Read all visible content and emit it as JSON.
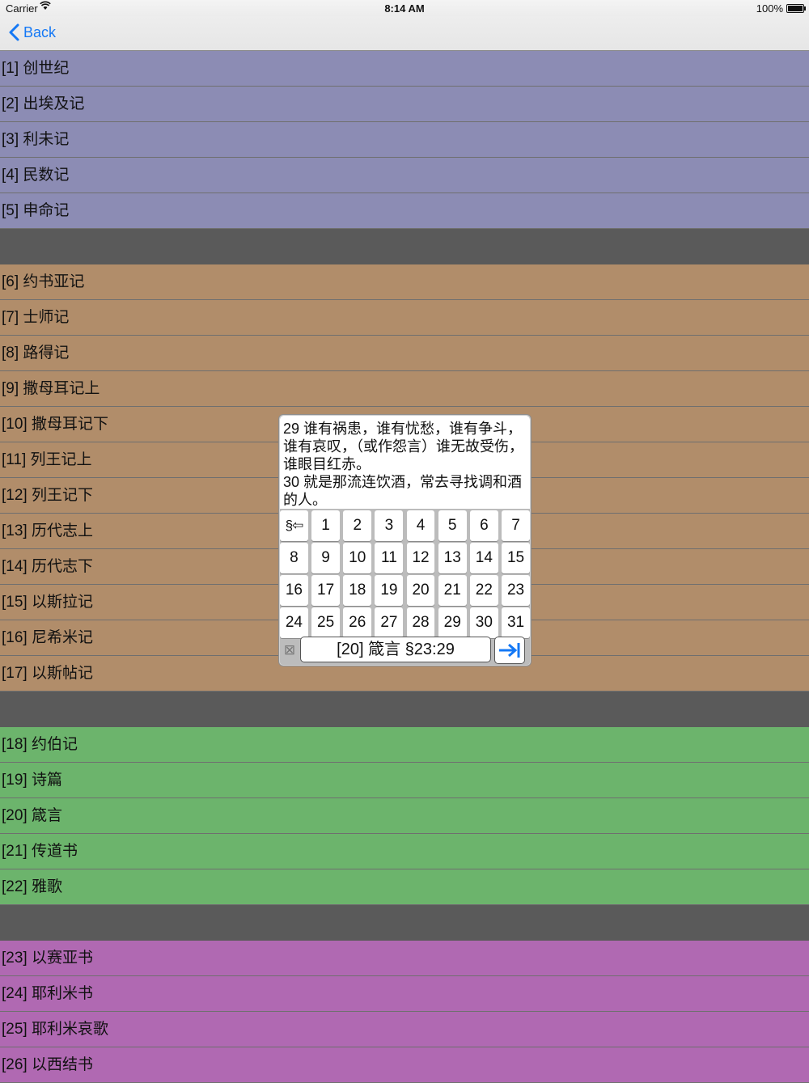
{
  "status": {
    "carrier": "Carrier",
    "time": "8:14 AM",
    "battery": "100%"
  },
  "nav": {
    "back_label": "Back"
  },
  "books": [
    {
      "label": "[1] 创世纪"
    },
    {
      "label": "[2] 出埃及记"
    },
    {
      "label": "[3] 利未记"
    },
    {
      "label": "[4] 民数记"
    },
    {
      "label": "[5] 申命记"
    },
    {
      "label": "[6] 约书亚记"
    },
    {
      "label": "[7] 士师记"
    },
    {
      "label": "[8] 路得记"
    },
    {
      "label": "[9] 撒母耳记上"
    },
    {
      "label": "[10] 撒母耳记下"
    },
    {
      "label": "[11] 列王记上"
    },
    {
      "label": "[12] 列王记下"
    },
    {
      "label": "[13] 历代志上"
    },
    {
      "label": "[14] 历代志下"
    },
    {
      "label": "[15] 以斯拉记"
    },
    {
      "label": "[16] 尼希米记"
    },
    {
      "label": "[17] 以斯帖记"
    },
    {
      "label": "[18] 约伯记"
    },
    {
      "label": "[19] 诗篇"
    },
    {
      "label": "[20] 箴言"
    },
    {
      "label": "[21] 传道书"
    },
    {
      "label": "[22] 雅歌"
    },
    {
      "label": "[23] 以赛亚书"
    },
    {
      "label": "[24] 耶利米书"
    },
    {
      "label": "[25] 耶利米哀歌"
    },
    {
      "label": "[26] 以西结书"
    }
  ],
  "colors": {
    "law": "#8c8cb4",
    "history": "#b18d6a",
    "poetry": "#6cb46c",
    "prophets": "#b069b2",
    "accent": "#1478f5"
  },
  "popup": {
    "verses": [
      "29  谁有祸患，谁有忧愁，谁有争斗，谁有哀叹，（或作怨言）谁无故受伤，谁眼目红赤。",
      "30  就是那流连饮酒，常去寻找调和酒的人。"
    ],
    "back_key": "§⇦",
    "keys": [
      "1",
      "2",
      "3",
      "4",
      "5",
      "6",
      "7",
      "8",
      "9",
      "10",
      "11",
      "12",
      "13",
      "14",
      "15",
      "16",
      "17",
      "18",
      "19",
      "20",
      "21",
      "22",
      "23",
      "24",
      "25",
      "26",
      "27",
      "28",
      "29",
      "30",
      "31"
    ],
    "clear_symbol": "⊠",
    "reference": "[20] 箴言 §23:29"
  }
}
